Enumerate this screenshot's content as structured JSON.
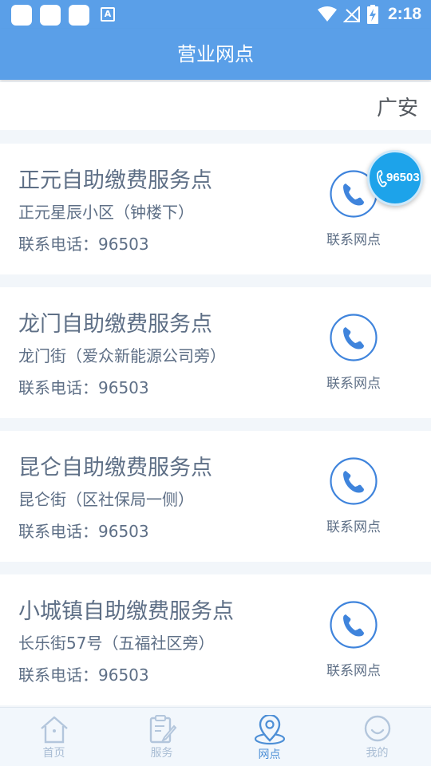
{
  "status_bar": {
    "time": "2:18"
  },
  "header": {
    "title": "营业网点"
  },
  "region": {
    "name": "广安"
  },
  "branches": [
    {
      "name": "正元自助缴费服务点",
      "address": "正元星辰小区（钟楼下）",
      "phone_label": "联系电话：",
      "phone": "96503",
      "contact_label": "联系网点"
    },
    {
      "name": "龙门自助缴费服务点",
      "address": "龙门街（爱众新能源公司旁）",
      "phone_label": "联系电话：",
      "phone": "96503",
      "contact_label": "联系网点"
    },
    {
      "name": "昆仑自助缴费服务点",
      "address": "昆仑街（区社保局一侧）",
      "phone_label": "联系电话：",
      "phone": "96503",
      "contact_label": "联系网点"
    },
    {
      "name": "小城镇自助缴费服务点",
      "address": "长乐街57号（五福社区旁）",
      "phone_label": "联系电话：",
      "phone": "96503",
      "contact_label": "联系网点"
    }
  ],
  "hotline": {
    "number": "96503",
    "icon": "phone-icon"
  },
  "bottom_nav": {
    "items": [
      {
        "label": "首页",
        "icon": "home-icon",
        "active": false
      },
      {
        "label": "服务",
        "icon": "clipboard-edit-icon",
        "active": false
      },
      {
        "label": "网点",
        "icon": "location-pin-icon",
        "active": true
      },
      {
        "label": "我的",
        "icon": "smiley-user-icon",
        "active": false
      }
    ]
  },
  "colors": {
    "brand_blue": "#5a9fe8",
    "text_slate": "#5e6f86",
    "icon_blue": "#3f84dc",
    "hotline_blue": "#1da3ea",
    "nav_inactive": "#a9bdd4"
  }
}
